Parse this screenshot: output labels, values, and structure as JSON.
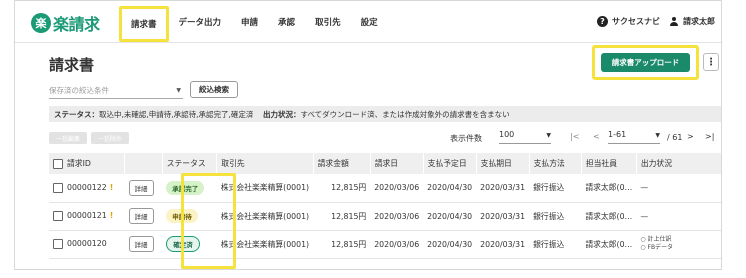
{
  "app": {
    "logo_mark": "楽",
    "logo_text": "楽請求"
  },
  "nav": [
    "請求書",
    "データ出力",
    "申請",
    "承認",
    "取引先",
    "設定"
  ],
  "header": {
    "help_label": "サクセスナビ",
    "user_name": "請求太郎"
  },
  "page": {
    "title": "請求書",
    "upload_button": "請求書アップロード",
    "more_button": "⋮"
  },
  "filter": {
    "placeholder": "保存済の絞込条件",
    "search_button": "絞込検索"
  },
  "status_bar": {
    "status_label": "ステータス：",
    "status_value": "取込中,未確認,申請待,承認待,承認完了,確定済",
    "output_label": "出力状況：",
    "output_value": "すべてダウンロード済、または作成対象外の請求書を含まない"
  },
  "toolbar": {
    "bulk_edit": "一括編集",
    "bulk_exclude": "一括除外",
    "display_count_label": "表示件数",
    "display_count": "100",
    "first": "|<",
    "prev": "<",
    "range": "1-61",
    "total": "/ 61",
    "next": ">",
    "last": ">|"
  },
  "table": {
    "headers": [
      "請求ID",
      "",
      "ステータス",
      "取引先",
      "請求金額",
      "請求日",
      "支払予定日",
      "支払期日",
      "支払方法",
      "担当社員",
      "出力状況"
    ],
    "rows": [
      {
        "id": "00000122",
        "warn": "!",
        "detail": "詳細",
        "status": "承認完了",
        "status_color": "#d6f2c9",
        "partner": "株式会社楽楽精算(0001)",
        "amount": "12,815円",
        "invoice_date": "2020/03/06",
        "planned_date": "2020/04/30",
        "due_date": "2020/03/31",
        "method": "銀行振込",
        "staff": "請求太郎(0…",
        "output": "—"
      },
      {
        "id": "00000121",
        "warn": "!",
        "detail": "詳細",
        "status": "申請待",
        "status_color": "#fbf3c4",
        "partner": "株式会社楽楽精算(0001)",
        "amount": "12,815円",
        "invoice_date": "2020/03/06",
        "planned_date": "2020/04/30",
        "due_date": "2020/03/31",
        "method": "銀行振込",
        "staff": "請求太郎(0…",
        "output": "—"
      },
      {
        "id": "00000120",
        "warn": "",
        "detail": "詳細",
        "status": "確定済",
        "status_color": "#e5f4ec",
        "partner": "株式会社楽楽精算(0001)",
        "amount": "12,815円",
        "invoice_date": "2020/03/06",
        "planned_date": "2020/04/30",
        "due_date": "2020/03/31",
        "method": "銀行振込",
        "staff": "請求太郎(0…",
        "output_line1": "○ 計上仕訳",
        "output_line2": "○ FBデータ"
      }
    ]
  }
}
